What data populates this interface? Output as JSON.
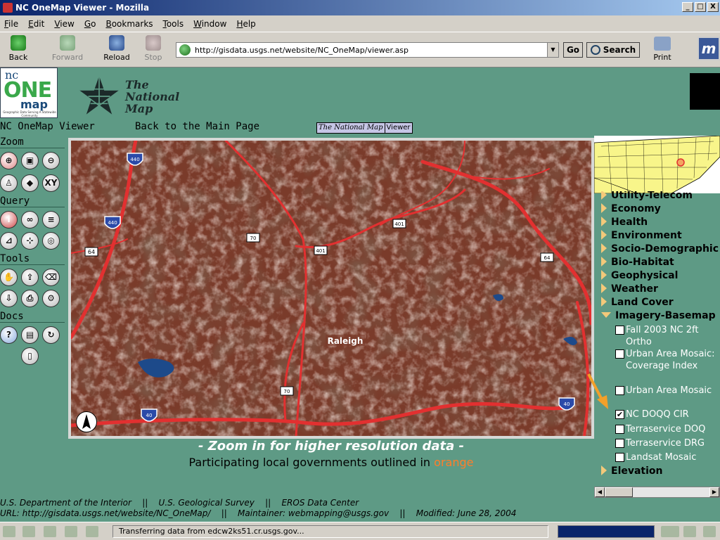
{
  "window": {
    "title": "NC OneMap Viewer - Mozilla",
    "controls": [
      "_",
      "□",
      "X"
    ]
  },
  "menu": [
    "File",
    "Edit",
    "View",
    "Go",
    "Bookmarks",
    "Tools",
    "Window",
    "Help"
  ],
  "nav": {
    "back": "Back",
    "forward": "Forward",
    "reload": "Reload",
    "stop": "Stop",
    "url": "http://gisdata.usgs.net/website/NC_OneMap/viewer.asp",
    "go": "Go",
    "search": "Search",
    "print": "Print"
  },
  "branding": {
    "logo_nc": "nc",
    "logo_one": "ONE",
    "logo_map": "map",
    "logo_sub": "Geographic Data Serving A Statewide Community",
    "national_map_line1": "The",
    "national_map_line2": "National",
    "national_map_line3": "Map"
  },
  "header": {
    "title": "NC OneMap Viewer",
    "back_link": "Back to the Main Page",
    "tnm_label": "The National Map",
    "viewer_label": "Viewer"
  },
  "tools": {
    "zoom": "Zoom",
    "query": "Query",
    "tools": "Tools",
    "docs": "Docs",
    "xy_label": "XY"
  },
  "map": {
    "city_label": "Raleigh",
    "shields": [
      "440",
      "440",
      "40",
      "40",
      "64",
      "401",
      "401",
      "70",
      "64",
      "70"
    ],
    "zoom_message": "- Zoom in for higher resolution data -",
    "participating_text": "Participating local governments outlined in",
    "participating_color_word": "orange",
    "orange_color": "#ff7e2a"
  },
  "layers": {
    "groups": [
      {
        "label": "Utility-Telecom",
        "expanded": false
      },
      {
        "label": "Economy",
        "expanded": false
      },
      {
        "label": "Health",
        "expanded": false
      },
      {
        "label": "Environment",
        "expanded": false
      },
      {
        "label": "Socio-Demographic",
        "expanded": false
      },
      {
        "label": "Bio-Habitat",
        "expanded": false
      },
      {
        "label": "Geophysical",
        "expanded": false
      },
      {
        "label": "Weather",
        "expanded": false
      },
      {
        "label": "Land Cover",
        "expanded": false
      },
      {
        "label": "Imagery-Basemap",
        "expanded": true
      },
      {
        "label": "Elevation",
        "expanded": false
      }
    ],
    "imagery_items": [
      {
        "label": "Fall 2003 NC 2ft Ortho",
        "checked": false
      },
      {
        "label": "Urban Area Mosaic: Coverage Index",
        "checked": false
      },
      {
        "label": "Urban Area Mosaic",
        "checked": false
      },
      {
        "label": "NC DOQQ CIR",
        "checked": true
      },
      {
        "label": "Terraservice DOQ",
        "checked": false
      },
      {
        "label": "Terraservice DRG",
        "checked": false
      },
      {
        "label": "Landsat Mosaic",
        "checked": false
      }
    ]
  },
  "footer": {
    "line1": "U.S. Department of the Interior    ||    U.S. Geological Survey    ||    EROS Data Center",
    "line2": "URL: http://gisdata.usgs.net/website/NC_OneMap/    ||    Maintainer: webmapping@usgs.gov    ||    Modified: June 28, 2004"
  },
  "status": {
    "text": "Transferring data from edcw2ks51.cr.usgs.gov...",
    "progress": 1.0
  },
  "colors": {
    "page_bg": "#5e9a85",
    "map_bg": "#7a3b2a",
    "road": "#e23030"
  }
}
